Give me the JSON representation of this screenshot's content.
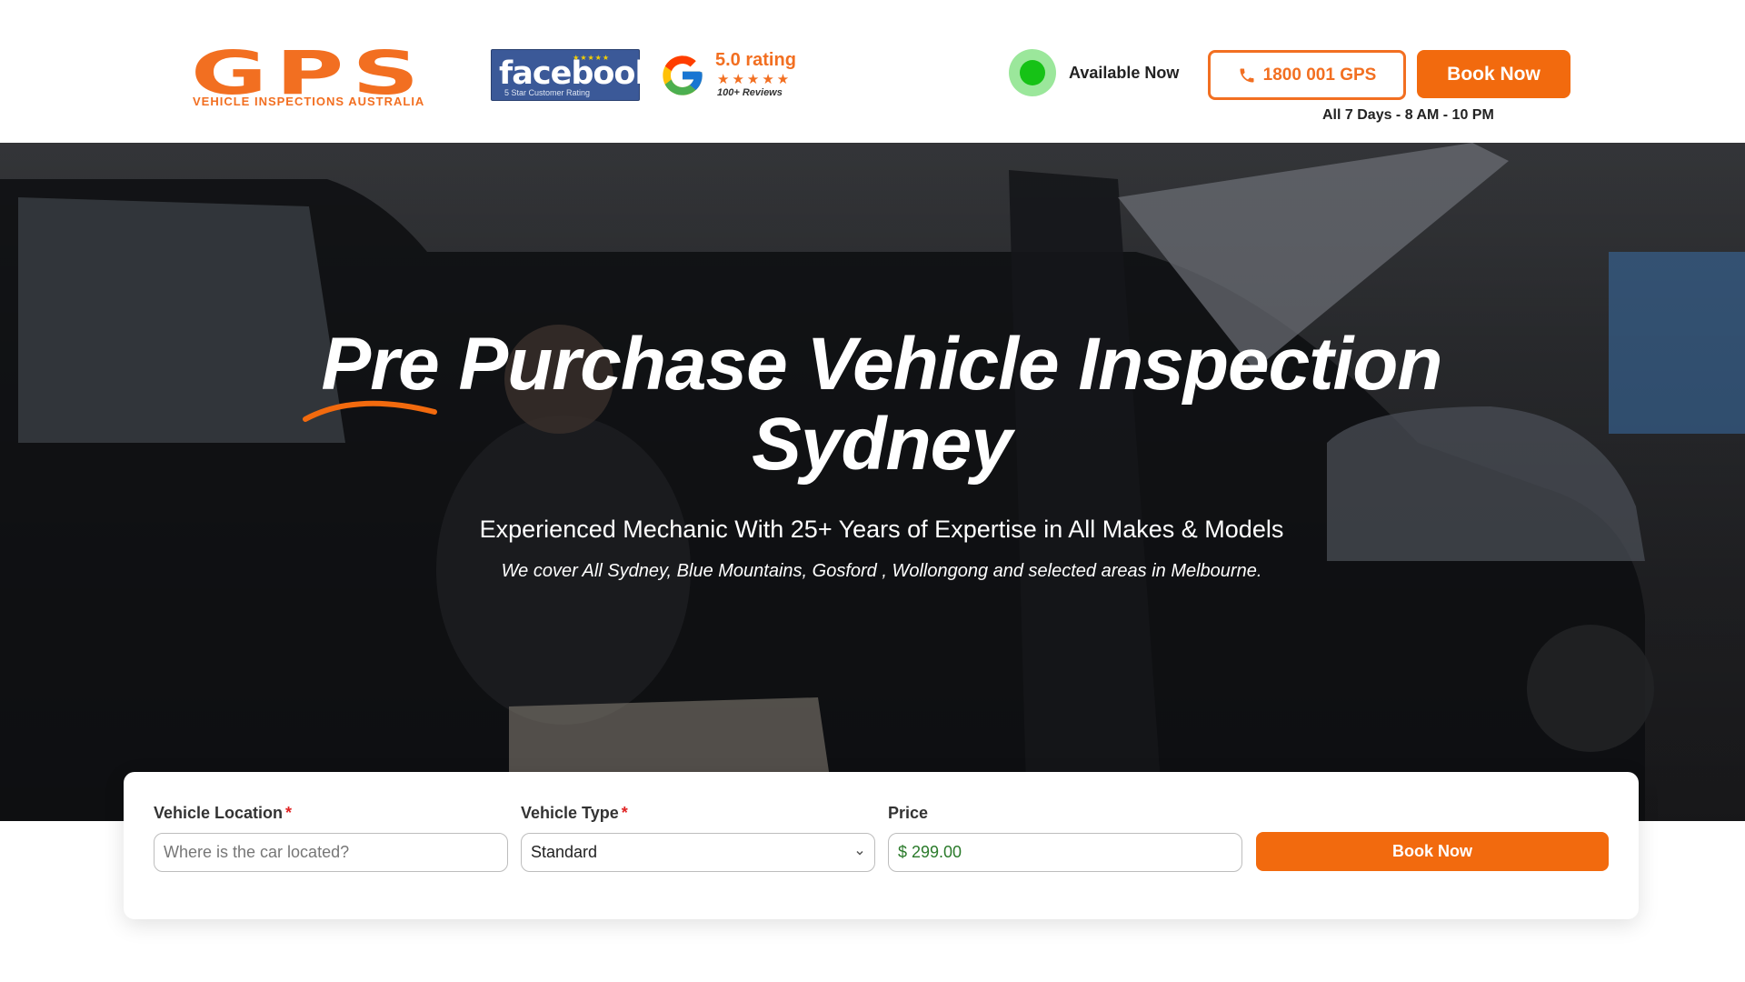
{
  "header": {
    "logo": {
      "word": "GPS",
      "tagline": "VEHICLE INSPECTIONS AUSTRALIA"
    },
    "facebook_badge": {
      "word": "facebook",
      "stars": "★★★★★",
      "caption": "5 Star Customer Rating"
    },
    "google_badge": {
      "rating": "5.0 rating",
      "stars": "★★★★★",
      "reviews": "100+ Reviews"
    },
    "availability": "Available Now",
    "phone_label": "1800 001 GPS",
    "book_label": "Book Now",
    "hours": "All 7 Days - 8 AM - 10 PM"
  },
  "hero": {
    "title_line1": "Pre Purchase Vehicle Inspection",
    "title_line2": "Sydney",
    "subtitle": "Experienced Mechanic With 25+ Years of Expertise in All Makes & Models",
    "coverage": "We cover All Sydney, Blue Mountains, Gosford , Wollongong and selected areas in Melbourne."
  },
  "booking_form": {
    "location": {
      "label": "Vehicle Location",
      "required_mark": "*",
      "placeholder": "Where is the car located?",
      "value": ""
    },
    "vehicle_type": {
      "label": "Vehicle Type",
      "required_mark": "*",
      "selected": "Standard"
    },
    "price": {
      "label": "Price",
      "value": "$ 299.00"
    },
    "submit_label": "Book Now"
  },
  "colors": {
    "brand_orange": "#f26a0e",
    "facebook_blue": "#3b5998",
    "available_green": "#16c216",
    "price_green": "#2a7a2a"
  }
}
